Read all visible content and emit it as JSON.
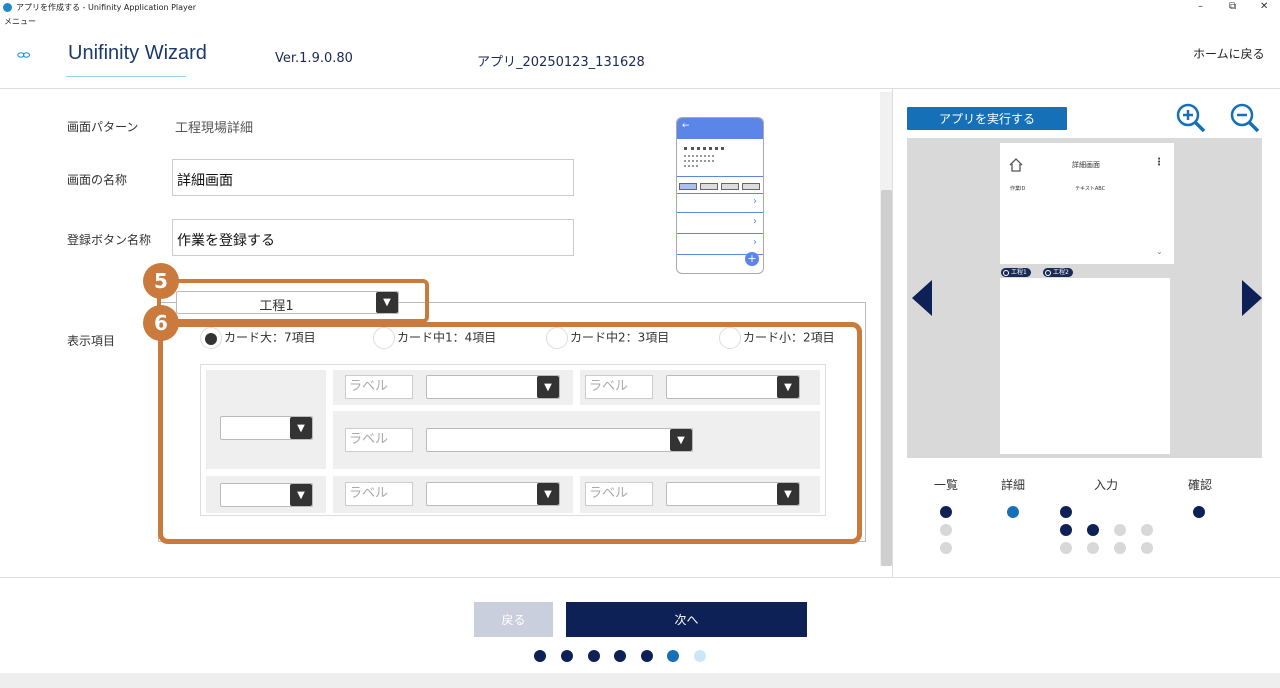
{
  "window": {
    "title": "アプリを作成する - Unifinity Application Player",
    "menu": "メニュー"
  },
  "header": {
    "logo_text": "Unifinity Wizard",
    "version": "Ver.1.9.0.80",
    "app_name": "アプリ_20250123_131628",
    "home_link": "ホームに戻る"
  },
  "form": {
    "pattern_label": "画面パターン",
    "pattern_value": "工程現場詳細",
    "screen_name_label": "画面の名称",
    "screen_name_value": "詳細画面",
    "register_label": "登録ボタン名称",
    "register_value": "作業を登録する",
    "display_label": "表示項目",
    "process_select": "工程1",
    "radios": [
      {
        "label": "カード大：7項目",
        "selected": true
      },
      {
        "label": "カード中1：4項目",
        "selected": false
      },
      {
        "label": "カード中2：3項目",
        "selected": false
      },
      {
        "label": "カード小：2項目",
        "selected": false
      }
    ],
    "label_placeholder": "ラベル"
  },
  "callouts": {
    "five": "5",
    "six": "6"
  },
  "preview": {
    "run_button": "アプリを実行する",
    "card_title": "詳細画面",
    "field_name": "作業ID",
    "field_value": "テキストABC",
    "chips": [
      "工程1",
      "工程2"
    ]
  },
  "steps": {
    "labels": [
      "一覧",
      "詳細",
      "入力",
      "確認"
    ]
  },
  "footer": {
    "back": "戻る",
    "next": "次へ"
  },
  "colors": {
    "accent": "#c97a3c",
    "navy": "#0d2157",
    "blue": "#1670b8",
    "active_dot": "#1670b8",
    "inactive_dot": "#d0d0d0"
  }
}
